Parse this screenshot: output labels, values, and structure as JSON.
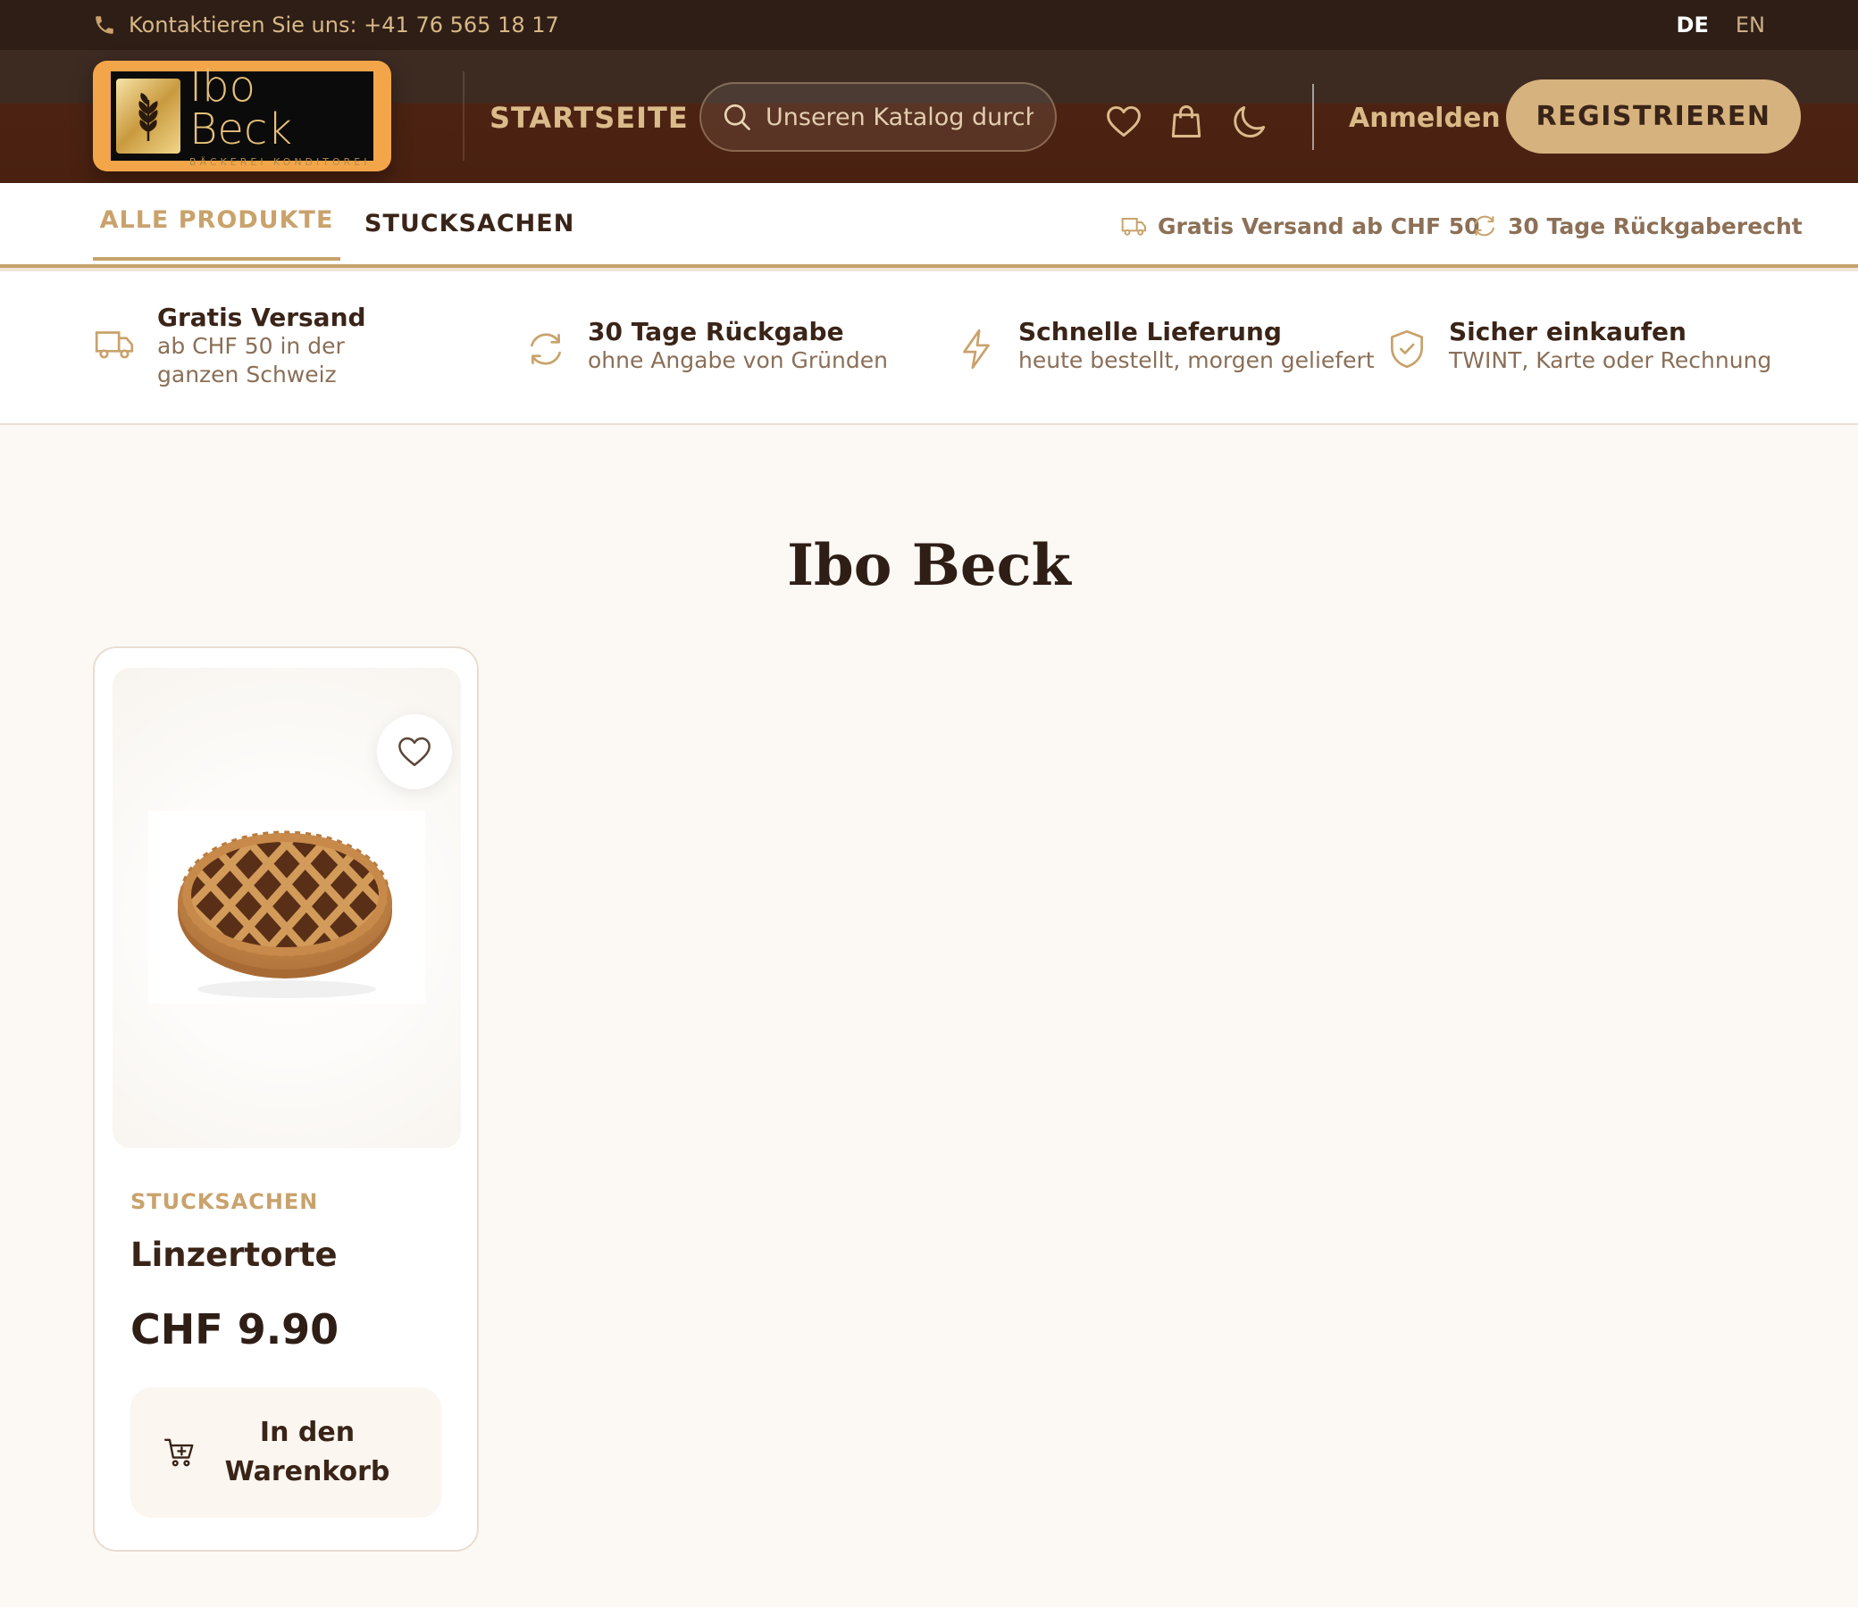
{
  "topbar": {
    "contact": "Kontaktieren Sie uns: +41 76 565 18 17",
    "languages": [
      "DE",
      "EN"
    ],
    "active_language": "DE"
  },
  "header": {
    "logo_name": "Ibo Beck",
    "logo_tagline": "BÄCKEREI KONDITOREI",
    "nav_home": "STARTSEITE",
    "search_placeholder": "Unseren Katalog durchsuchen",
    "login": "Anmelden",
    "register": "REGISTRIEREN",
    "icons": [
      "heart-icon",
      "shopping-bag-icon",
      "moon-icon"
    ]
  },
  "subnav": {
    "tabs": [
      {
        "label": "ALLE PRODUKTE",
        "active": true
      },
      {
        "label": "STUCKSACHEN",
        "active": false
      }
    ],
    "perks": [
      {
        "icon": "truck-icon",
        "label": "Gratis Versand ab CHF 50"
      },
      {
        "icon": "refresh-icon",
        "label": "30 Tage Rückgaberecht"
      }
    ]
  },
  "features": [
    {
      "icon": "truck-icon",
      "title": "Gratis Versand",
      "subtitle": "ab CHF 50 in der ganzen Schweiz"
    },
    {
      "icon": "refresh-icon",
      "title": "30 Tage Rückgabe",
      "subtitle": "ohne Angabe von Gründen"
    },
    {
      "icon": "lightning-icon",
      "title": "Schnelle Lieferung",
      "subtitle": "heute bestellt, morgen geliefert"
    },
    {
      "icon": "shield-check-icon",
      "title": "Sicher einkaufen",
      "subtitle": "TWINT, Karte oder Rechnung"
    }
  ],
  "main": {
    "title": "Ibo Beck",
    "products": [
      {
        "category": "STUCKSACHEN",
        "name": "Linzertorte",
        "price": "CHF 9.90",
        "cart_label": "In den Warenkorb"
      }
    ]
  },
  "colors": {
    "accent": "#c9a26c",
    "dark_brown": "#3a2418",
    "topbar_bg": "#2e1e16",
    "register_bg": "#d6b27e",
    "logo_frame": "#f3a649"
  }
}
